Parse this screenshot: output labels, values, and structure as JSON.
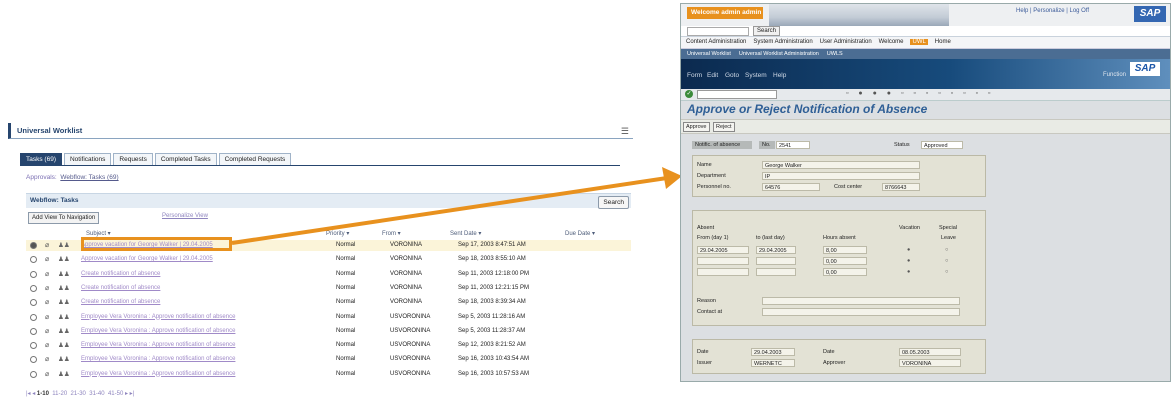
{
  "uwl": {
    "title": "Universal Worklist",
    "tabs": [
      "Tasks (69)",
      "Notifications",
      "Requests",
      "Completed Tasks",
      "Completed Requests"
    ],
    "approvals_prefix": "Approvals",
    "approvals_link": "Webflow: Tasks (69)",
    "section_title": "Webflow: Tasks",
    "search_label": "Search",
    "add_view_label": "Add View To Navigation",
    "personalize_label": "Personalize View",
    "columns": {
      "subject": "Subject",
      "priority": "Priority",
      "from": "From",
      "sent": "Sent Date",
      "due": "Due Date"
    },
    "rows": [
      {
        "subject": "Approve vacation for George Walker | 29.04.2005",
        "priority": "Normal",
        "from": "VORONINA",
        "sent": "Sep 17, 2003 8:47:51 AM"
      },
      {
        "subject": "Approve vacation for George Walker | 29.04.2005",
        "priority": "Normal",
        "from": "VORONINA",
        "sent": "Sep 18, 2003 8:55:10 AM"
      },
      {
        "subject": "Create notification of absence",
        "priority": "Normal",
        "from": "VORONINA",
        "sent": "Sep 11, 2003 12:18:00 PM"
      },
      {
        "subject": "Create notification of absence",
        "priority": "Normal",
        "from": "VORONINA",
        "sent": "Sep 11, 2003 12:21:15 PM"
      },
      {
        "subject": "Create notification of absence",
        "priority": "Normal",
        "from": "VORONINA",
        "sent": "Sep 18, 2003 8:39:34 AM"
      },
      {
        "subject": "Employee Vera Voronina : Approve notification of absence",
        "priority": "Normal",
        "from": "USVORONINA",
        "sent": "Sep 5, 2003 11:28:16 AM"
      },
      {
        "subject": "Employee Vera Voronina : Approve notification of absence",
        "priority": "Normal",
        "from": "USVORONINA",
        "sent": "Sep 5, 2003 11:28:37 AM"
      },
      {
        "subject": "Employee Vera Voronina : Approve notification of absence",
        "priority": "Normal",
        "from": "USVORONINA",
        "sent": "Sep 12, 2003 8:21:52 AM"
      },
      {
        "subject": "Employee Vera Voronina : Approve notification of absence",
        "priority": "Normal",
        "from": "USVORONINA",
        "sent": "Sep 16, 2003 10:43:54 AM"
      },
      {
        "subject": "Employee Vera Voronina : Approve notification of absence",
        "priority": "Normal",
        "from": "USVORONINA",
        "sent": "Sep 16, 2003 10:57:53 AM"
      }
    ],
    "pager": {
      "current": "1-10",
      "pages": [
        "11-20",
        "21-30",
        "31-40",
        "41-50"
      ]
    }
  },
  "sap": {
    "welcome": "Welcome admin admin",
    "toplinks": "Help | Personalize | Log Off",
    "logo": "SAP",
    "search_button": "Search",
    "topnav": [
      "Content Administration",
      "System Administration",
      "User Administration",
      "Welcome",
      "UWL",
      "Home"
    ],
    "subnav": [
      "Universal Worklist",
      "Universal Worklist Administration",
      "UWLS"
    ],
    "menu": [
      "Form",
      "Edit",
      "Goto",
      "System",
      "Help"
    ],
    "function_label": "Function",
    "title": "Approve or Reject Notification of Absence",
    "buttons": [
      "Approve",
      "Reject"
    ],
    "header": {
      "notif_label": "Notific. of absence",
      "no_label": "No.",
      "no_value": "2541",
      "status_label": "Status",
      "status_value": "Approved"
    },
    "employee": {
      "name_label": "Name",
      "name_value": "George Walker",
      "dept_label": "Department",
      "dept_value": "IP",
      "pers_label": "Personnel no.",
      "pers_value": "64576",
      "cc_label": "Cost center",
      "cc_value": "8766643"
    },
    "absence": {
      "absent_label": "Absent",
      "from_label": "From (day 1)",
      "to_label": "to (last day)",
      "hours_label": "Hours absent",
      "vacation_label": "Vacation",
      "special_label": "Special",
      "leave_label": "Leave",
      "from_value": "29.04.2005",
      "to_value": "29.04.2005",
      "hours": [
        "8,00",
        "0,00",
        "0,00"
      ],
      "reason_label": "Reason",
      "contact_label": "Contact at"
    },
    "footer": {
      "date_label": "Date",
      "date_value": "29.04.2003",
      "date2_label": "Date",
      "date2_value": "08.05.2003",
      "issuer_label": "Issuer",
      "issuer_value": "WERNETC",
      "approver_label": "Approver",
      "approver_value": "VORONINA"
    }
  },
  "colors": {
    "accent": "#e8911e",
    "uwl_blue": "#26456e",
    "sap_title": "#2f5f96"
  }
}
